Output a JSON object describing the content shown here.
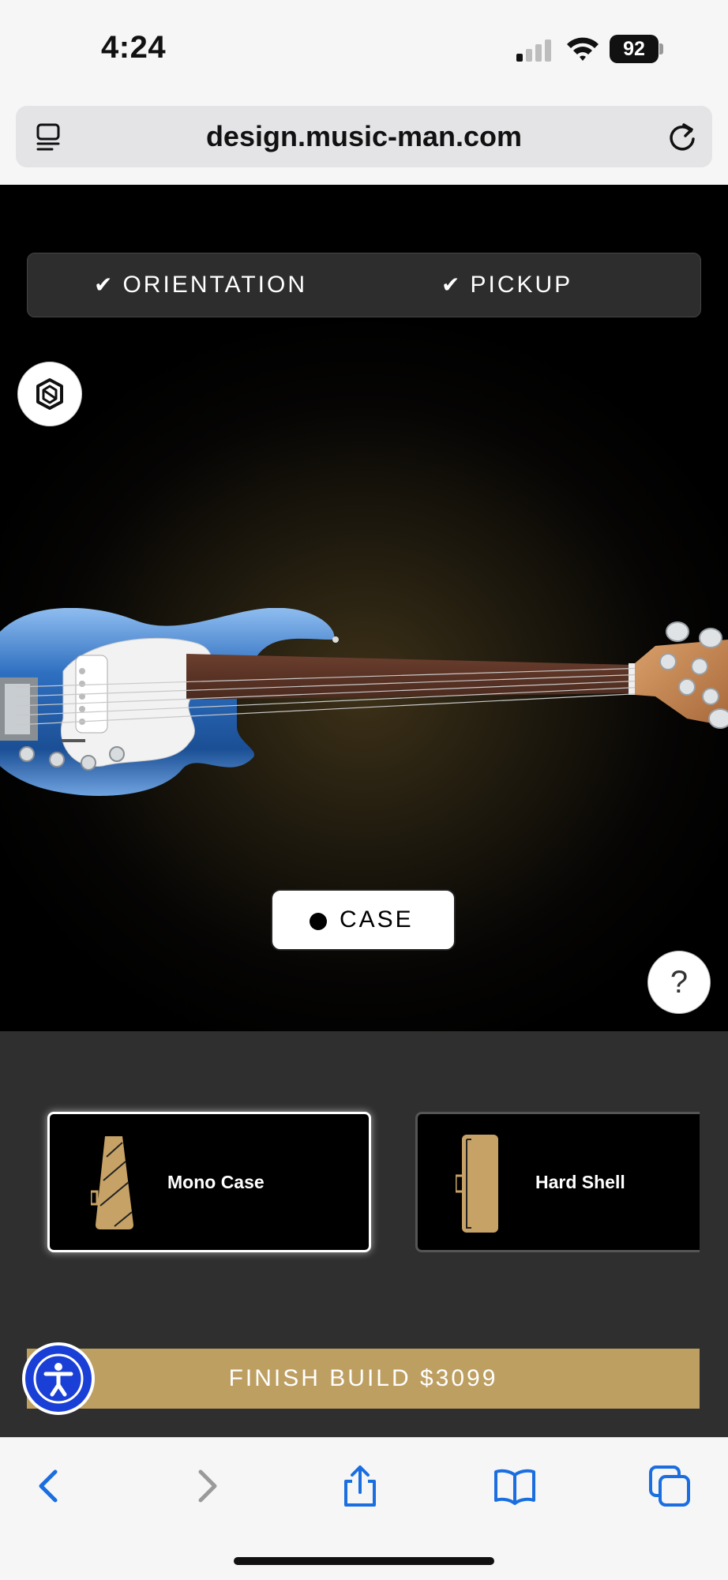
{
  "status_bar": {
    "time": "4:24",
    "battery": "92"
  },
  "browser": {
    "url": "design.music-man.com"
  },
  "configurator": {
    "steps": [
      {
        "label": "ORIENTATION",
        "done": true
      },
      {
        "label": "PICKUP",
        "done": true
      }
    ],
    "current_step_label": "CASE",
    "help_label": "?"
  },
  "case_options": [
    {
      "label": "Mono Case",
      "selected": true
    },
    {
      "label": "Hard Shell",
      "selected": false
    }
  ],
  "finish_button": {
    "label": "FINISH BUILD $3099"
  },
  "colors": {
    "accent_gold": "#bd9f62",
    "panel_bg": "#2f2f2f",
    "body_blue": "#2e6fc0",
    "a11y_blue": "#1a3fd6",
    "ios_blue": "#1a6ee0"
  },
  "icons": {
    "tab": "tab-overview-icon",
    "reload": "reload-icon",
    "view_toggle": "cube-icon",
    "back": "chevron-left-icon",
    "forward": "chevron-right-icon",
    "share": "share-icon",
    "bookmarks": "book-icon",
    "tabs": "tabs-icon",
    "accessibility": "accessibility-icon"
  }
}
